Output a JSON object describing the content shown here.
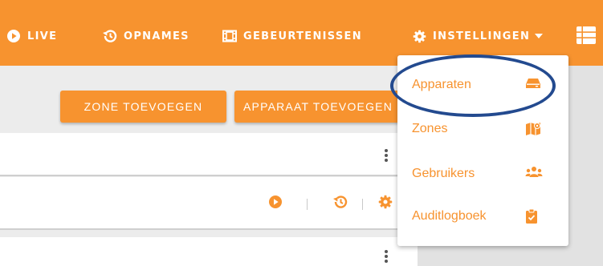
{
  "nav": {
    "live": "LIVE",
    "opnames": "OPNAMES",
    "gebeurtenissen": "GEBEURTENISSEN",
    "instellingen": "INSTELLINGEN"
  },
  "toolbar": {
    "add_zone": "ZONE TOEVOEGEN",
    "add_device": "APPARAAT TOEVOEGEN"
  },
  "dropdown": {
    "items": [
      {
        "label": "Apparaten",
        "icon": "hdd-icon"
      },
      {
        "label": "Zones",
        "icon": "map-icon"
      },
      {
        "label": "Gebruikers",
        "icon": "users-icon"
      },
      {
        "label": "Auditlogboek",
        "icon": "clipboard-check-icon"
      }
    ]
  },
  "colors": {
    "brand_orange": "#f7932f",
    "highlight_blue": "#234a8f"
  }
}
